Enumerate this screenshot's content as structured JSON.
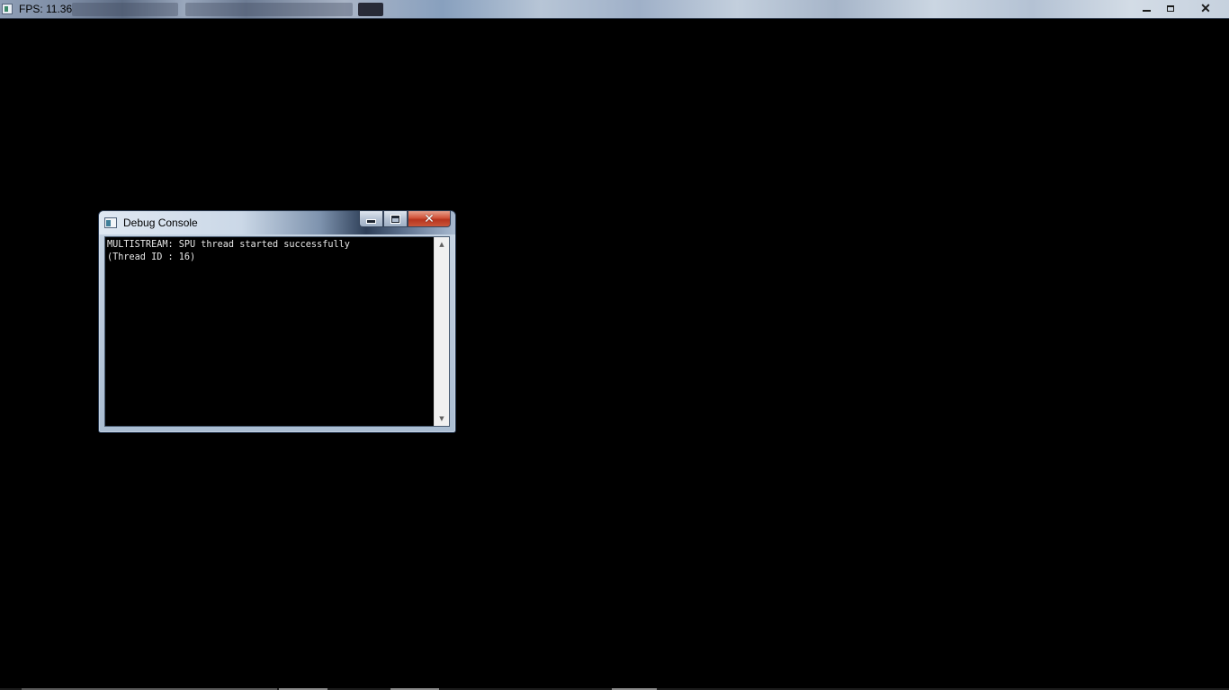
{
  "main_window": {
    "title": "FPS: 11.36",
    "icon": "app-icon",
    "controls": {
      "minimize_icon": "minimize-icon",
      "maximize_icon": "restore-icon",
      "close_icon": "close-icon",
      "close_glyph": "✕"
    }
  },
  "debug_console": {
    "title": "Debug Console",
    "icon": "console-icon",
    "close_glyph": "✕",
    "lines": [
      "MULTISTREAM: SPU thread started successfully",
      "(Thread ID : 16)"
    ],
    "scroll_up_glyph": "▲",
    "scroll_down_glyph": "▼"
  },
  "colors": {
    "background": "#000000",
    "console_text": "#e8e8e8",
    "close_button": "#c94a31"
  }
}
